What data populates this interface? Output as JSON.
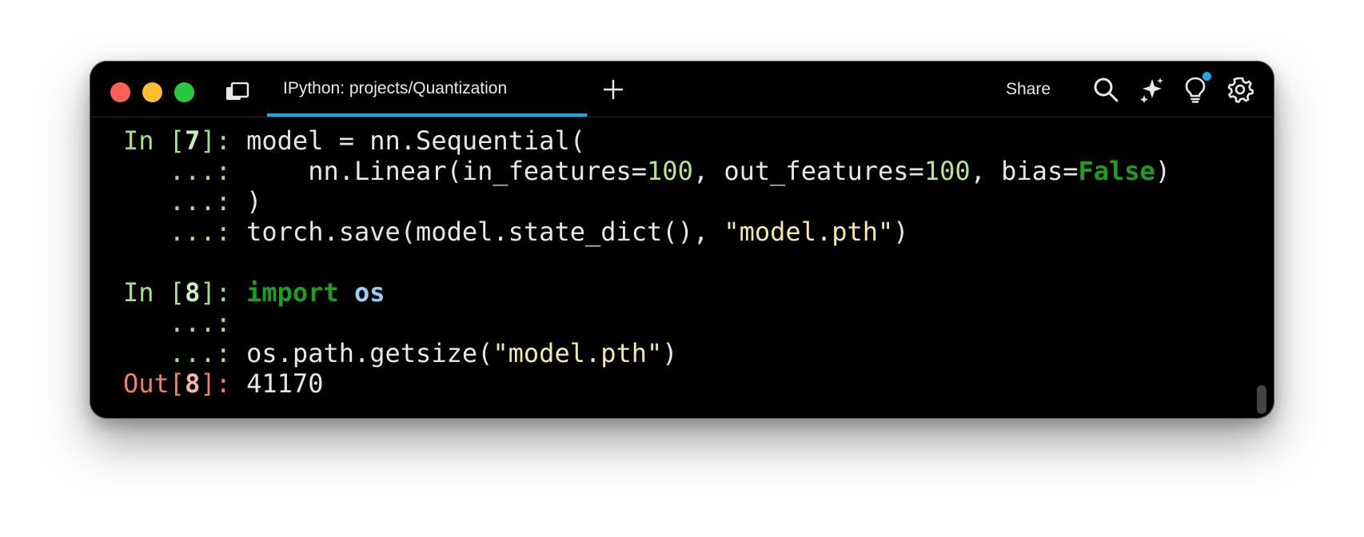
{
  "window": {
    "tab_title": "IPython: projects/Quantization",
    "share_label": "Share"
  },
  "icons": {
    "panel": "panels-icon",
    "new_tab": "plus-icon",
    "search": "search-icon",
    "ai": "sparkle-icon",
    "idea": "lightbulb-icon",
    "settings": "gear-icon",
    "scroll": "scroll-to-bottom-icon"
  },
  "colors": {
    "accent": "#22a8e0",
    "background": "#000000"
  },
  "terminal": {
    "in7_prompt_a": "In [",
    "in7_num": "7",
    "in7_prompt_b": "]: ",
    "line1": "model = nn.Sequential(",
    "cont": "   ...: ",
    "line2_a": "    nn.Linear(in_features=",
    "line2_n1": "100",
    "line2_b": ", out_features=",
    "line2_n2": "100",
    "line2_c": ", bias=",
    "line2_kw": "False",
    "line2_d": ")",
    "line3": ")",
    "line4_a": "torch.save(model.state_dict(), ",
    "line4_str": "\"model.pth\"",
    "line4_b": ")",
    "in8_prompt_a": "In [",
    "in8_num": "8",
    "in8_prompt_b": "]: ",
    "line5_kw": "import",
    "line5_sp": " ",
    "line5_mod": "os",
    "line7_a": "os.path.getsize(",
    "line7_str": "\"model.pth\"",
    "line7_b": ")",
    "out8_prompt_a": "Out[",
    "out8_num": "8",
    "out8_prompt_b": "]: ",
    "out8_value": "41170"
  }
}
